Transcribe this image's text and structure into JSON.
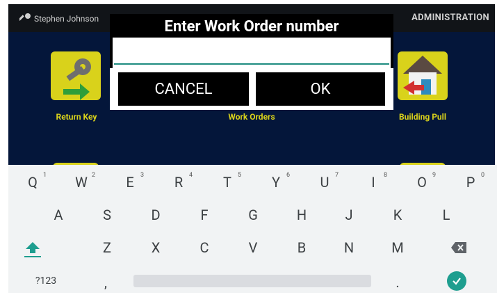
{
  "header": {
    "user_name": "Stephen Johnson",
    "role": "ADMINISTRATION"
  },
  "tiles": [
    {
      "label": "Return Key",
      "icon": "key-return-icon"
    },
    {
      "label": "Work Orders",
      "icon": "work-orders-icon"
    },
    {
      "label": "Building Pull",
      "icon": "building-pull-icon"
    }
  ],
  "dialog": {
    "title": "Enter Work Order number",
    "input_value": "",
    "cancel_label": "CANCEL",
    "ok_label": "OK"
  },
  "keyboard": {
    "row1": [
      {
        "key": "Q",
        "hint": "1"
      },
      {
        "key": "W",
        "hint": "2"
      },
      {
        "key": "E",
        "hint": "3"
      },
      {
        "key": "R",
        "hint": "4"
      },
      {
        "key": "T",
        "hint": "5"
      },
      {
        "key": "Y",
        "hint": "6"
      },
      {
        "key": "U",
        "hint": "7"
      },
      {
        "key": "I",
        "hint": "8"
      },
      {
        "key": "O",
        "hint": "9"
      },
      {
        "key": "P",
        "hint": "0"
      }
    ],
    "row2": [
      "A",
      "S",
      "D",
      "F",
      "G",
      "H",
      "J",
      "K",
      "L"
    ],
    "row3": [
      "Z",
      "X",
      "C",
      "V",
      "B",
      "N",
      "M"
    ],
    "symbols_label": "?123",
    "comma": ",",
    "period": "."
  },
  "colors": {
    "accent": "#1e9e8f",
    "tile": "#d9d21b",
    "background": "#04163a"
  }
}
